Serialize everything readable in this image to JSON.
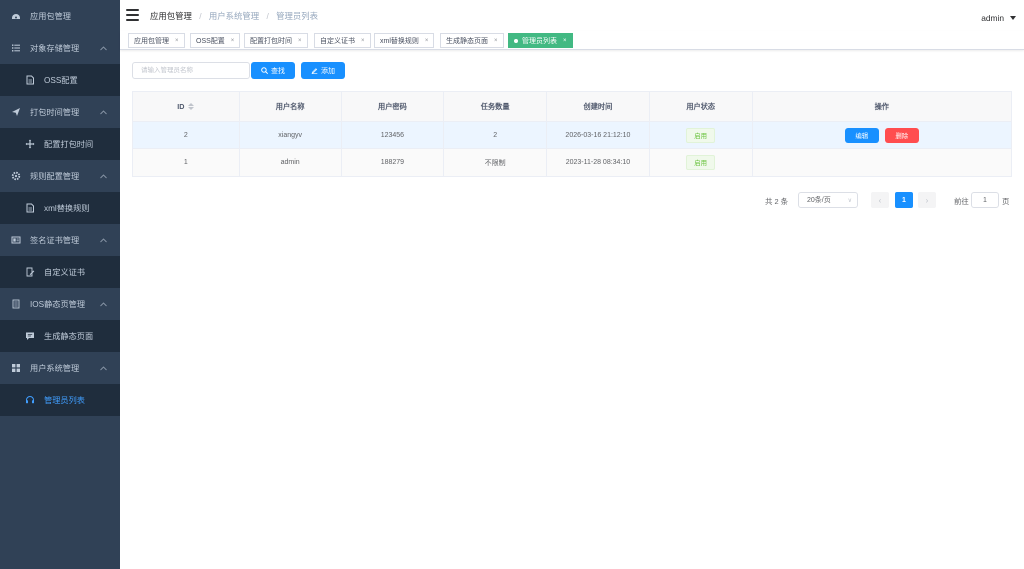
{
  "sidebar": {
    "items": [
      {
        "label": "应用包管理",
        "icon": "dashboard-icon",
        "type": "parent",
        "expandable": false
      },
      {
        "label": "对象存储管理",
        "icon": "list-icon",
        "type": "parent",
        "expandable": true
      },
      {
        "label": "OSS配置",
        "icon": "document-icon",
        "type": "child"
      },
      {
        "label": "打包时间管理",
        "icon": "paper-plane-icon",
        "type": "parent",
        "expandable": true
      },
      {
        "label": "配置打包时间",
        "icon": "move-icon",
        "type": "child"
      },
      {
        "label": "规则配置管理",
        "icon": "gear-icon",
        "type": "parent",
        "expandable": true
      },
      {
        "label": "xml替换规则",
        "icon": "document-icon",
        "type": "child"
      },
      {
        "label": "签名证书管理",
        "icon": "certificate-icon",
        "type": "parent",
        "expandable": true
      },
      {
        "label": "自定义证书",
        "icon": "edit-document-icon",
        "type": "child"
      },
      {
        "label": "IOS静态页管理",
        "icon": "page-icon",
        "type": "parent",
        "expandable": true
      },
      {
        "label": "生成静态页面",
        "icon": "message-icon",
        "type": "child"
      },
      {
        "label": "用户系统管理",
        "icon": "grid-icon",
        "type": "parent",
        "expandable": true
      },
      {
        "label": "管理员列表",
        "icon": "headset-icon",
        "type": "child",
        "active": true
      }
    ]
  },
  "header": {
    "breadcrumb": [
      "应用包管理",
      "用户系统管理",
      "管理员列表"
    ],
    "user": "admin"
  },
  "tags": [
    {
      "label": "应用包管理",
      "active": false
    },
    {
      "label": "OSS配置",
      "active": false
    },
    {
      "label": "配置打包时间",
      "active": false
    },
    {
      "label": "自定义证书",
      "active": false
    },
    {
      "label": "xml替换规则",
      "active": false
    },
    {
      "label": "生成静态页面",
      "active": false
    },
    {
      "label": "管理员列表",
      "active": true
    }
  ],
  "toolbar": {
    "search_placeholder": "请输入管理员名称",
    "search_label": "查找",
    "add_label": "添加"
  },
  "table": {
    "columns": [
      "ID",
      "用户名称",
      "用户密码",
      "任务数量",
      "创建时间",
      "用户状态",
      "操作"
    ],
    "rows": [
      {
        "id": "2",
        "username": "xiangyv",
        "password": "123456",
        "tasks": "2",
        "created": "2026-03-16 21:12:10",
        "status": "启用",
        "edit_label": "编辑",
        "delete_label": "删除"
      },
      {
        "id": "1",
        "username": "admin",
        "password": "188279",
        "tasks": "不限制",
        "created": "2023-11-28 08:34:10",
        "status": "启用"
      }
    ]
  },
  "pagination": {
    "total": "共 2 条",
    "page_size": "20条/页",
    "current_page": "1",
    "goto_label": "前往",
    "goto_value": "1",
    "goto_suffix": "页"
  },
  "colors": {
    "sidebar_bg": "#304156",
    "submenu_bg": "#1f2d3d",
    "active_text": "#409eff",
    "primary": "#1890ff",
    "danger": "#ff4d4f",
    "tag_active": "#42b983",
    "success": "#67c23a"
  }
}
